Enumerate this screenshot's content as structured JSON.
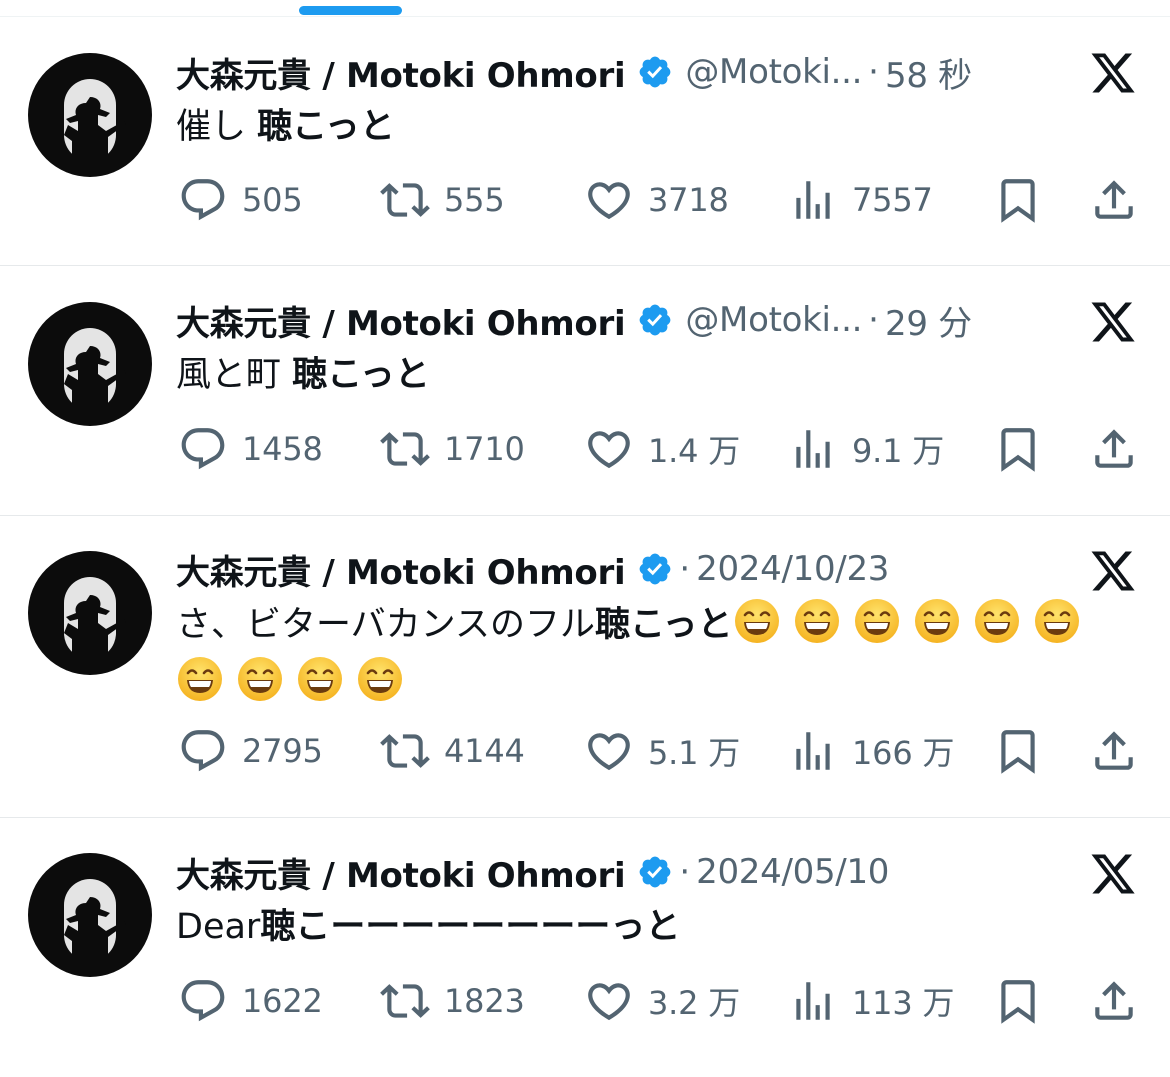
{
  "feed": {
    "tweets": [
      {
        "display_name": "大森元貴 / Motoki Ohmori",
        "handle": "@Motoki...",
        "time": "58 秒",
        "text_plain": "催し ",
        "text_bold": "聴こっと",
        "emoji_count": 0,
        "replies": "505",
        "retweets": "555",
        "likes": "3718",
        "views": "7557"
      },
      {
        "display_name": "大森元貴 / Motoki Ohmori",
        "handle": "@Motoki...",
        "time": "29 分",
        "text_plain": "風と町 ",
        "text_bold": "聴こっと",
        "emoji_count": 0,
        "replies": "1458",
        "retweets": "1710",
        "likes": "1.4 万",
        "views": "9.1 万"
      },
      {
        "display_name": "大森元貴 / Motoki Ohmori",
        "handle": "",
        "time": "2024/10/23",
        "text_plain": "さ、ビターバカンスのフル",
        "text_bold": "聴こっと",
        "emoji_count": 10,
        "emoji_name": "grinning-face-with-smiling-eyes",
        "replies": "2795",
        "retweets": "4144",
        "likes": "5.1 万",
        "views": "166 万"
      },
      {
        "display_name": "大森元貴 / Motoki Ohmori",
        "handle": "",
        "time": "2024/05/10",
        "text_plain": "Dear",
        "text_bold": "聴こーーーーーーーーっと",
        "emoji_count": 0,
        "replies": "1622",
        "retweets": "1823",
        "likes": "3.2 万",
        "views": "113 万"
      }
    ]
  },
  "icons": {
    "verified": "verified-badge-icon",
    "platform": "x-logo-icon",
    "reply": "reply-icon",
    "retweet": "retweet-icon",
    "like": "heart-icon",
    "views": "views-chart-icon",
    "bookmark": "bookmark-icon",
    "share": "share-icon"
  },
  "colors": {
    "accent": "#1d9bf0",
    "text_primary": "#0f1419",
    "text_secondary": "#536471",
    "divider": "#eff3f4"
  }
}
